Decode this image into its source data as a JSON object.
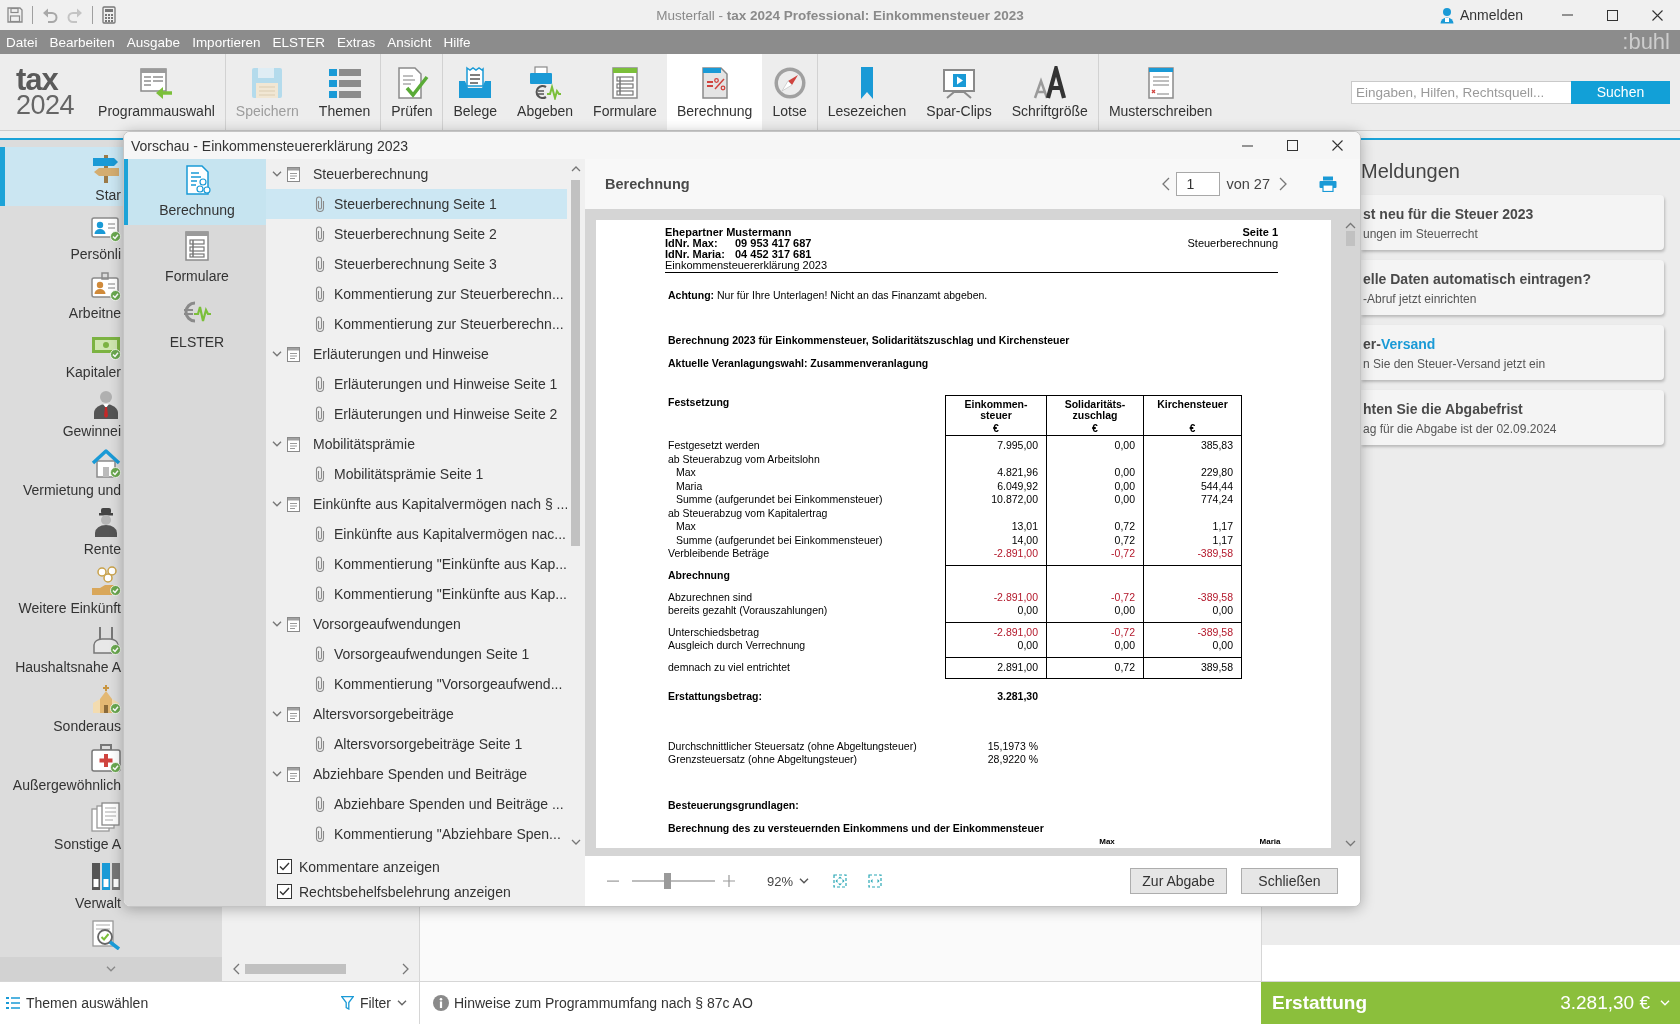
{
  "window": {
    "title": "Musterfall - **tax 2024 Professional: Einkommensteuer 2023**",
    "login": "Anmelden"
  },
  "menu": [
    "Datei",
    "Bearbeiten",
    "Ausgabe",
    "Importieren",
    "ELSTER",
    "Extras",
    "Ansicht",
    "Hilfe"
  ],
  "brand": ":buhl",
  "ribbon": {
    "logo": [
      "tax",
      "2024"
    ],
    "groups": [
      {
        "items": [
          {
            "label": "Programmauswahl",
            "kind": "switch",
            "disabled": false,
            "selected": false
          }
        ]
      },
      {
        "items": [
          {
            "label": "Speichern",
            "kind": "save",
            "disabled": true,
            "selected": false
          },
          {
            "label": "Themen",
            "kind": "list",
            "disabled": false,
            "selected": false
          }
        ]
      },
      {
        "items": [
          {
            "label": "Prüfen",
            "kind": "check",
            "disabled": false,
            "selected": false
          }
        ]
      },
      {
        "items": [
          {
            "label": "Belege",
            "kind": "receipts",
            "disabled": false,
            "selected": false
          },
          {
            "label": "Abgeben",
            "kind": "submit",
            "disabled": false,
            "selected": false
          },
          {
            "label": "Formulare",
            "kind": "forms",
            "disabled": false,
            "selected": false
          },
          {
            "label": "Berechnung",
            "kind": "calc",
            "disabled": false,
            "selected": true
          },
          {
            "label": "Lotse",
            "kind": "compass",
            "disabled": false,
            "selected": false
          }
        ]
      },
      {
        "items": [
          {
            "label": "Lesezeichen",
            "kind": "bookmark",
            "disabled": false,
            "selected": false
          },
          {
            "label": "Spar-Clips",
            "kind": "video",
            "disabled": false,
            "selected": false
          },
          {
            "label": "Schriftgröße",
            "kind": "fontsize",
            "disabled": false,
            "selected": false
          }
        ]
      },
      {
        "items": [
          {
            "label": "Musterschreiben",
            "kind": "letter",
            "disabled": false,
            "selected": false
          }
        ]
      }
    ],
    "search": {
      "placeholder": "Eingaben, Hilfen, Rechtsquell...",
      "button": "Suchen"
    }
  },
  "sidebar": {
    "items": [
      {
        "label": "Star",
        "kind": "signpost",
        "selected": true,
        "done": false
      },
      {
        "label": "Persönli",
        "kind": "idcard",
        "selected": false,
        "done": true
      },
      {
        "label": "Arbeitne",
        "kind": "worker",
        "selected": false,
        "done": true
      },
      {
        "label": "Kapitaler",
        "kind": "money",
        "selected": false,
        "done": true
      },
      {
        "label": "Gewinnei",
        "kind": "manager",
        "selected": false,
        "done": false
      },
      {
        "label": "Vermietung und",
        "kind": "house",
        "selected": false,
        "done": true
      },
      {
        "label": "Rente",
        "kind": "pensioner",
        "selected": false,
        "done": false
      },
      {
        "label": "Weitere Einkünft",
        "kind": "coins",
        "selected": false,
        "done": true
      },
      {
        "label": "Haushaltsnahe A",
        "kind": "vacuum",
        "selected": false,
        "done": true
      },
      {
        "label": "Sonderaus",
        "kind": "church",
        "selected": false,
        "done": true
      },
      {
        "label": "Außergewöhnlich",
        "kind": "medkit",
        "selected": false,
        "done": true
      },
      {
        "label": "Sonstige A",
        "kind": "documents",
        "selected": false,
        "done": false
      },
      {
        "label": "Verwalt",
        "kind": "binders",
        "selected": false,
        "done": false
      },
      {
        "kind": "review",
        "selected": false,
        "done": false
      }
    ]
  },
  "messages": {
    "title": "Meldungen",
    "items": [
      {
        "title": "st neu für die Steuer 2023",
        "text": "ungen im Steuerrecht"
      },
      {
        "title": "elle Daten automatisch eintragen?",
        "text": "-Abruf jetzt einrichten"
      },
      {
        "title": "er-",
        "title_accent": "Versand",
        "text": "n Sie den Steuer-Versand jetzt ein"
      },
      {
        "title": "hten Sie die Abgabefrist",
        "text": "ag für die Abgabe ist der 02.09.2024"
      }
    ]
  },
  "status_bar": {
    "topics": "Themen auswählen",
    "filter": "Filter",
    "hint": "Hinweise zum Programmumfang nach § 87c AO",
    "refund": {
      "label": "Erstattung",
      "amount": "3.281,30 €"
    }
  },
  "dialog": {
    "title": "Vorschau - Einkommensteuererklärung 2023",
    "nav": [
      {
        "label": "Berechnung",
        "kind": "calc",
        "selected": true
      },
      {
        "label": "Formulare",
        "kind": "forms",
        "selected": false
      },
      {
        "label": "ELSTER",
        "kind": "elster",
        "selected": false
      }
    ],
    "tree": [
      {
        "label": "Steuerberechnung",
        "expanded": true,
        "children": [
          {
            "label": "Steuerberechnung Seite 1",
            "selected": true
          },
          {
            "label": "Steuerberechnung Seite 2",
            "selected": false
          },
          {
            "label": "Steuerberechnung Seite 3",
            "selected": false
          },
          {
            "label": "Kommentierung zur Steuerberechn...",
            "selected": false
          },
          {
            "label": "Kommentierung zur Steuerberechn...",
            "selected": false
          }
        ]
      },
      {
        "label": "Erläuterungen und Hinweise",
        "expanded": true,
        "children": [
          {
            "label": "Erläuterungen und Hinweise Seite 1",
            "selected": false
          },
          {
            "label": "Erläuterungen und Hinweise Seite 2",
            "selected": false
          }
        ]
      },
      {
        "label": "Mobilitätsprämie",
        "expanded": true,
        "children": [
          {
            "label": "Mobilitätsprämie Seite 1",
            "selected": false
          }
        ]
      },
      {
        "label": "Einkünfte aus Kapitalvermögen nach § ...",
        "expanded": true,
        "children": [
          {
            "label": "Einkünfte aus Kapitalvermögen nac...",
            "selected": false
          },
          {
            "label": "Kommentierung \"Einkünfte aus Kap...",
            "selected": false
          },
          {
            "label": "Kommentierung \"Einkünfte aus Kap...",
            "selected": false
          }
        ]
      },
      {
        "label": "Vorsorgeaufwendungen",
        "expanded": true,
        "children": [
          {
            "label": "Vorsorgeaufwendungen Seite 1",
            "selected": false
          },
          {
            "label": "Kommentierung \"Vorsorgeaufwend...",
            "selected": false
          }
        ]
      },
      {
        "label": "Altersvorsorgebeiträge",
        "expanded": true,
        "children": [
          {
            "label": "Altersvorsorgebeiträge Seite 1",
            "selected": false
          }
        ]
      },
      {
        "label": "Abziehbare Spenden und Beiträge",
        "expanded": true,
        "children": [
          {
            "label": "Abziehbare Spenden und Beiträge ...",
            "selected": false
          },
          {
            "label": "Kommentierung \"Abziehbare Spen...",
            "selected": false
          }
        ]
      }
    ],
    "options": [
      {
        "label": "Kommentare anzeigen",
        "checked": true
      },
      {
        "label": "Rechtsbehelfsbelehrung anzeigen",
        "checked": true
      }
    ],
    "preview": {
      "title": "Berechnung",
      "page": "1",
      "total": "von 27",
      "zoom": {
        "level": 0.42,
        "value": "92%"
      },
      "buttons": [
        "Zur Abgabe",
        "Schließen"
      ],
      "document": {
        "name": "Ehepartner Mustermann",
        "ids": [
          {
            "label": "IdNr. Max:",
            "value": "09 953 417 687"
          },
          {
            "label": "IdNr. Maria:",
            "value": "04 452 317 681"
          }
        ],
        "form": "Einkommensteuererklärung 2023",
        "page": "Seite 1",
        "section": "Steuerberechnung",
        "notice": "**Achtung:** Nur für Ihre Unterlagen! Nicht an das Finanzamt abgeben.",
        "heading": "Berechnung 2023 für Einkommensteuer, Solidaritätszuschlag und Kirchensteuer",
        "subheading": "Aktuelle Veranlagungswahl: Zusammenveranlagung",
        "table": {
          "title": "Festsetzung",
          "columns": [
            {
              "lines": [
                "Einkommen-",
                "steuer"
              ],
              "unit": "€"
            },
            {
              "lines": [
                "Solidaritäts-",
                "zuschlag"
              ],
              "unit": "€"
            },
            {
              "lines": [
                "Kirchensteuer"
              ],
              "unit": "€"
            }
          ],
          "blocks": [
            {
              "rows": [
                {
                  "label": "Festgesetzt werden",
                  "values": [
                    "7.995,00",
                    "0,00",
                    "385,83"
                  ],
                  "negative": false
                },
                {
                  "label": "ab Steuerabzug vom Arbeitslohn",
                  "children": [
                    {
                      "label": "Max",
                      "values": [
                        "4.821,96",
                        "0,00",
                        "229,80"
                      ],
                      "negative": false
                    },
                    {
                      "label": "Maria",
                      "values": [
                        "6.049,92",
                        "0,00",
                        "544,44"
                      ],
                      "negative": false
                    },
                    {
                      "label": "Summe (aufgerundet bei Einkommensteuer)",
                      "values": [
                        "10.872,00",
                        "0,00",
                        "774,24"
                      ],
                      "negative": false
                    }
                  ]
                },
                {
                  "label": "ab Steuerabzug vom Kapitalertrag",
                  "children": [
                    {
                      "label": "Max",
                      "values": [
                        "13,01",
                        "0,72",
                        "1,17"
                      ],
                      "negative": false
                    },
                    {
                      "label": "Summe (aufgerundet bei Einkommensteuer)",
                      "values": [
                        "14,00",
                        "0,72",
                        "1,17"
                      ],
                      "negative": false
                    }
                  ]
                },
                {
                  "label": "Verbleibende Beträge",
                  "values": [
                    "-2.891,00",
                    "-0,72",
                    "-389,58"
                  ],
                  "negative": true
                }
              ]
            },
            {
              "title": "Abrechnung",
              "rows": [
                {
                  "label": "Abzurechnen sind",
                  "values": [
                    "-2.891,00",
                    "-0,72",
                    "-389,58"
                  ],
                  "negative": true
                },
                {
                  "label": "bereits gezahlt (Vorauszahlungen)",
                  "values": [
                    "0,00",
                    "0,00",
                    "0,00"
                  ],
                  "negative": false
                }
              ]
            },
            {
              "rows": [
                {
                  "label": "Unterschiedsbetrag",
                  "values": [
                    "-2.891,00",
                    "-0,72",
                    "-389,58"
                  ],
                  "negative": true
                },
                {
                  "label": "Ausgleich durch Verrechnung",
                  "values": [
                    "0,00",
                    "0,00",
                    "0,00"
                  ],
                  "negative": false
                }
              ]
            },
            {
              "rows": [
                {
                  "label": "demnach zu viel entrichtet",
                  "values": [
                    "2.891,00",
                    "0,72",
                    "389,58"
                  ],
                  "negative": false
                }
              ]
            }
          ]
        },
        "refund": {
          "label": "Erstattungsbetrag:",
          "value": "3.281,30"
        },
        "rates": [
          {
            "label": "Durchschnittlicher Steuersatz (ohne Abgeltungsteuer)",
            "value": "15,1973 %"
          },
          {
            "label": "Grenzsteuersatz (ohne Abgeltungsteuer)",
            "value": "28,9220 %"
          }
        ],
        "basis_title": "Besteuerungsgrundlagen:",
        "basis_heading": "Berechnung des zu versteuernden Einkommens und der Einkommensteuer",
        "basis_columns": [
          "Max",
          "Maria"
        ]
      }
    }
  }
}
